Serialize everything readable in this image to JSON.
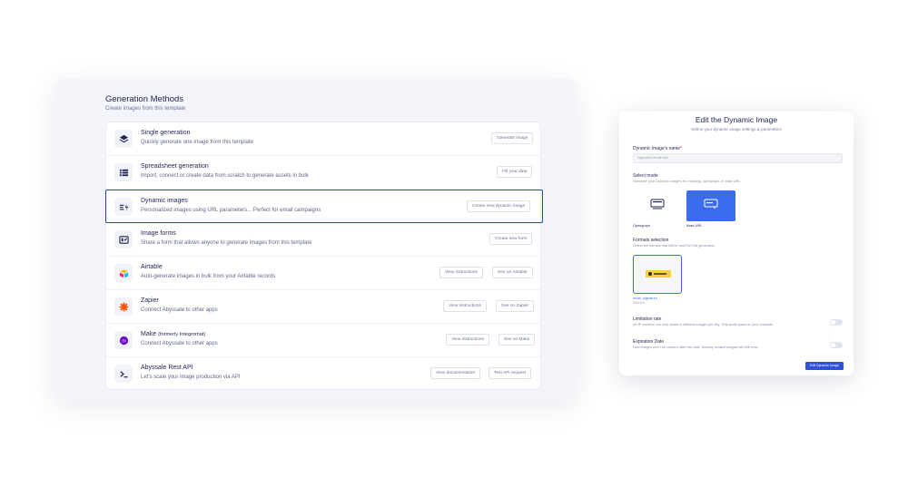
{
  "generation": {
    "title": "Generation Methods",
    "subtitle": "Create images from this template",
    "methods": [
      {
        "name": "Single generation",
        "desc": "Quickly generate one image from this template",
        "buttons": [
          "Generate image"
        ]
      },
      {
        "name": "Spreadsheet generation",
        "desc": "Import, connect or create data from scratch to generate assets in bulk",
        "buttons": [
          "Fill your data"
        ]
      },
      {
        "name": "Dynamic images",
        "desc": "Personalized images using URL parameters... Perfect for email campaigns",
        "buttons": [
          "Create new dynamic image"
        ]
      },
      {
        "name": "Image forms",
        "desc": "Share a form that allows anyone to generate images from this template",
        "buttons": [
          "Create new form"
        ]
      },
      {
        "name": "Airtable",
        "desc": "Auto-generate images in bulk from your Airtable records",
        "buttons": [
          "View instructions",
          "See on Airtable"
        ]
      },
      {
        "name": "Zapier",
        "desc": "Connect Abyssale to other apps",
        "buttons": [
          "View instructions",
          "See on Zapier"
        ]
      },
      {
        "name": "Make",
        "name_suffix": "(formerly Integromat)",
        "desc": "Connect Abyssale to other apps",
        "buttons": [
          "View instructions",
          "See on Make"
        ]
      },
      {
        "name": "Abyssale Rest API",
        "desc": "Let's scale your image production via API",
        "buttons": [
          "View documentation",
          "Test API request"
        ]
      }
    ]
  },
  "dialog": {
    "title": "Edit the Dynamic Image",
    "subtitle": "Define your dynamic image settings & parameters",
    "name_label": "Dynamic Image's name",
    "name_required": "*",
    "name_value": "Signature email test",
    "mode_label": "Select mode",
    "mode_help": "Generate your Dynamic image's for emailing, opengraph, or base URL",
    "modes": [
      "Opengraph",
      "Base URL"
    ],
    "selected_mode": "Base URL",
    "formats_label": "Formats selection",
    "formats_help": "Select the formats that will be used for this generation",
    "format_name": "email_signature",
    "format_size": "600x160",
    "limitation_label": "Limitation rate",
    "limitation_help": "An IP address can only create 5 different images per day. This avoid spam on your template",
    "limitation_enabled": false,
    "expiration_label": "Expiration Date",
    "expiration_help": "New images won't be created after this date. Already created images will still exist.",
    "expiration_enabled": false,
    "submit_label": "Edit Dynamic Image"
  },
  "colors": {
    "accent": "#3b6cf0",
    "highlight_border": "#2a4a9e",
    "submit": "#2f50d8",
    "panel_bg": "#f3f5fb"
  },
  "icons": {
    "single": "layers-icon",
    "spreadsheet": "list-icon",
    "dynamic": "dynamic-image-icon",
    "forms": "form-icon",
    "airtable": "airtable-logo-icon",
    "zapier": "zapier-logo-icon",
    "make": "make-logo-icon",
    "api": "terminal-icon",
    "opengraph": "opengraph-icon",
    "base_url": "base-url-icon"
  }
}
